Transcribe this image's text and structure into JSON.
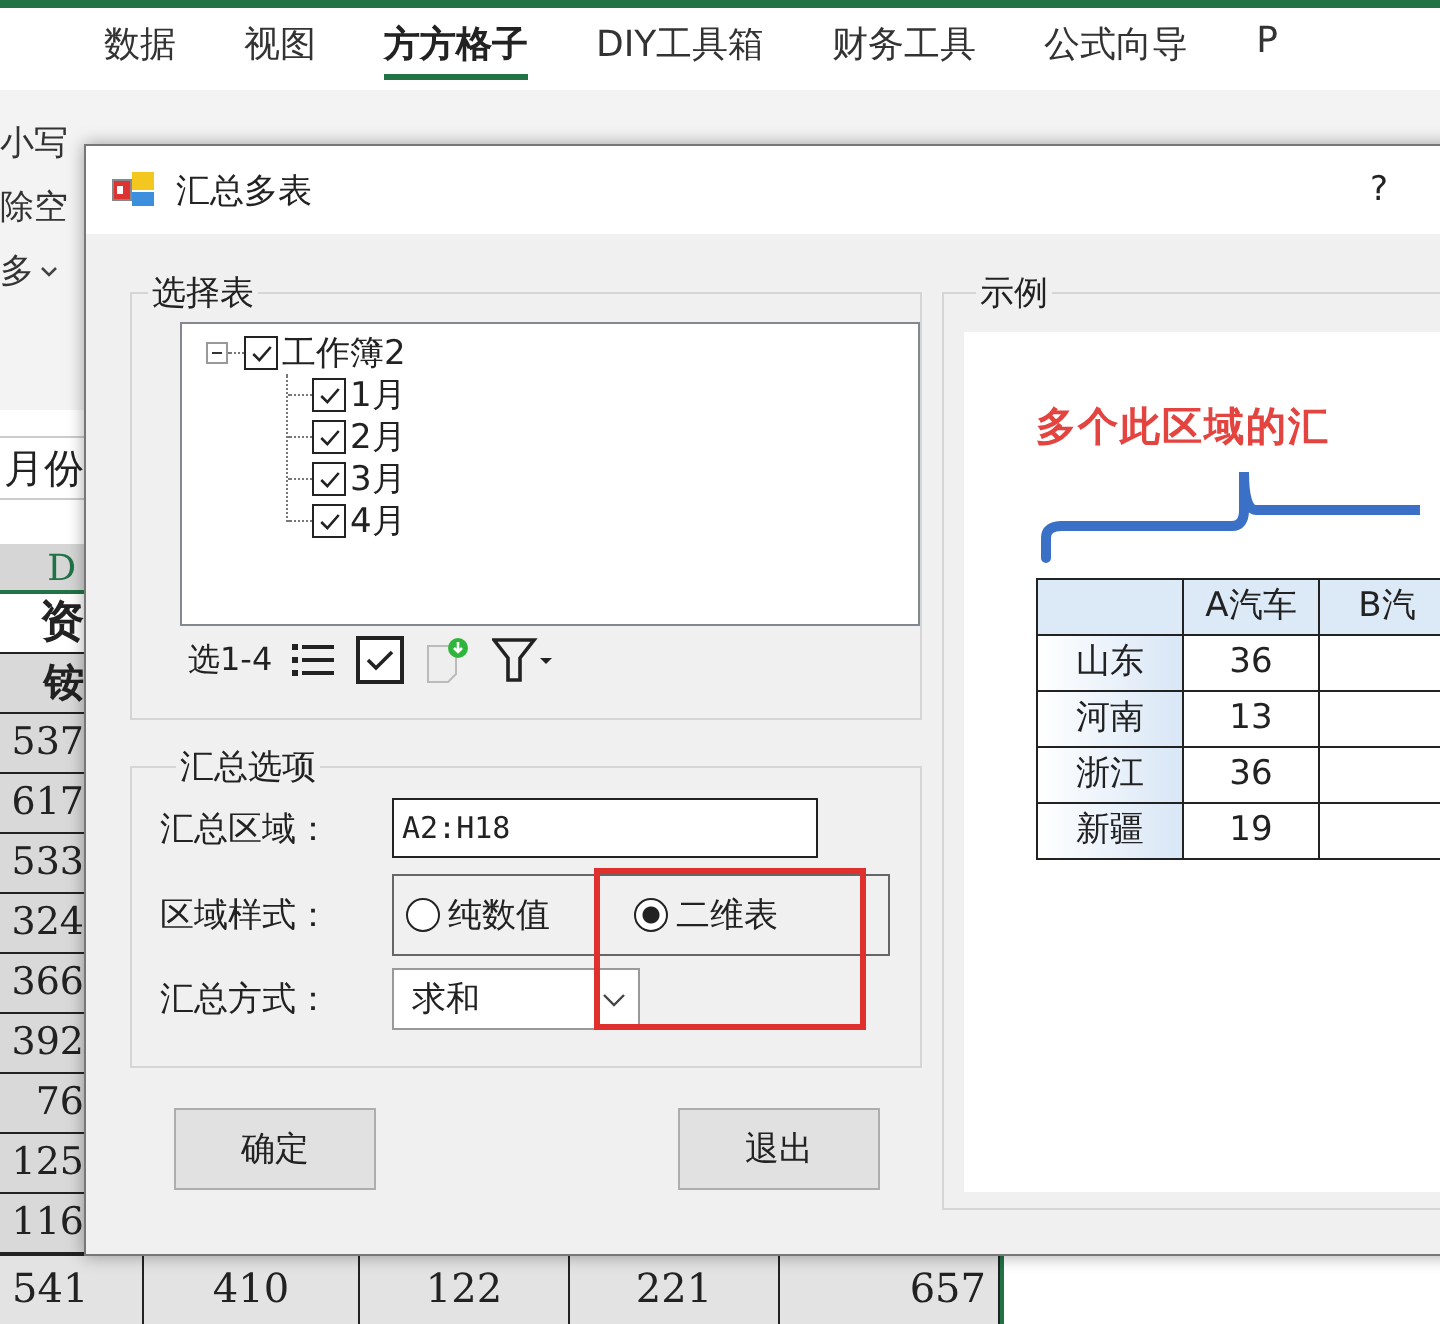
{
  "excel": {
    "tabs": [
      {
        "label": "数据",
        "selected": false
      },
      {
        "label": "视图",
        "selected": false
      },
      {
        "label": "方方格子",
        "selected": true
      },
      {
        "label": "DIY工具箱",
        "selected": false
      },
      {
        "label": "财务工具",
        "selected": false
      },
      {
        "label": "公式向导",
        "selected": false
      },
      {
        "label": "P",
        "selected": false
      }
    ],
    "ribbon_items": [
      {
        "label": "小写",
        "dropdown": false
      },
      {
        "label": "除空",
        "dropdown": false
      },
      {
        "label": "多",
        "dropdown": true
      }
    ],
    "name_box": "月份",
    "column_header": "D",
    "cells": [
      {
        "text": "资",
        "kind": "title"
      },
      {
        "text": "铵",
        "kind": "header"
      },
      {
        "text": "537",
        "kind": "number"
      },
      {
        "text": "617",
        "kind": "number"
      },
      {
        "text": "533",
        "kind": "number"
      },
      {
        "text": "324",
        "kind": "number"
      },
      {
        "text": "366",
        "kind": "number"
      },
      {
        "text": "392",
        "kind": "number"
      },
      {
        "text": "76",
        "kind": "number"
      },
      {
        "text": "125",
        "kind": "number"
      },
      {
        "text": "116",
        "kind": "number"
      }
    ],
    "total_row": [
      "541",
      "410",
      "122",
      "221",
      "657"
    ]
  },
  "dialog": {
    "title": "汇总多表",
    "help": "?",
    "select_group": {
      "title": "选择表",
      "tree": [
        {
          "label": "工作簿2",
          "checked": true,
          "expanded": true,
          "children": [
            {
              "label": "1月",
              "checked": true
            },
            {
              "label": "2月",
              "checked": true
            },
            {
              "label": "3月",
              "checked": true
            },
            {
              "label": "4月",
              "checked": true
            }
          ]
        }
      ],
      "toolbar_label": "选1-4"
    },
    "options_group": {
      "title": "汇总选项",
      "fields": [
        {
          "kind": "text",
          "label": "汇总区域：",
          "value": "A2:H18"
        },
        {
          "kind": "radio",
          "label": "区域样式：",
          "options": [
            {
              "label": "纯数值",
              "selected": false
            },
            {
              "label": "二维表",
              "selected": true
            }
          ]
        },
        {
          "kind": "dropdown",
          "label": "汇总方式：",
          "value": "求和"
        }
      ]
    },
    "buttons": [
      "确定",
      "退出"
    ],
    "example": {
      "title": "示例",
      "caption": "多个此区域的汇",
      "table": {
        "columns": [
          "A汽车",
          "B汽"
        ],
        "rows": [
          {
            "region": "山东",
            "value": "36"
          },
          {
            "region": "河南",
            "value": "13"
          },
          {
            "region": "浙江",
            "value": "36"
          },
          {
            "region": "新疆",
            "value": "19"
          }
        ]
      }
    }
  }
}
